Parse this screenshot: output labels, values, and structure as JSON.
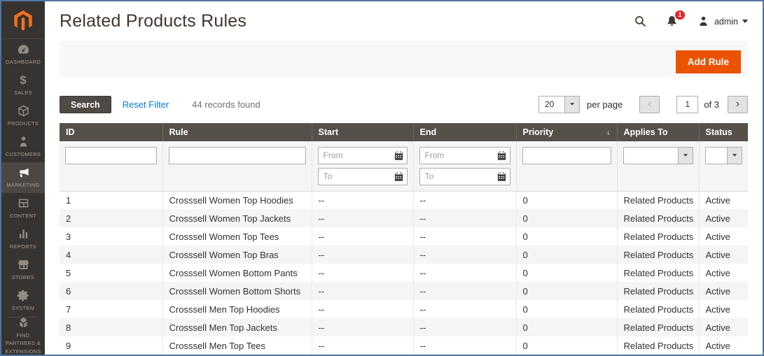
{
  "header": {
    "title": "Related Products Rules",
    "user_name": "admin",
    "notification_count": "1"
  },
  "panel": {
    "add_rule_label": "Add Rule"
  },
  "toolbar": {
    "search_label": "Search",
    "reset_filter_label": "Reset Filter",
    "records_found": "44 records found",
    "page_size": "20",
    "per_page_label": "per page",
    "current_page": "1",
    "of_label": "of 3",
    "prev_icon": "‹",
    "next_icon": "›"
  },
  "sidebar": {
    "items": [
      {
        "id": "dashboard",
        "label": "DASHBOARD",
        "icon": "dashboard-icon",
        "active": false
      },
      {
        "id": "sales",
        "label": "SALES",
        "icon": "sales-icon",
        "active": false
      },
      {
        "id": "products",
        "label": "PRODUCTS",
        "icon": "products-icon",
        "active": false
      },
      {
        "id": "customers",
        "label": "CUSTOMERS",
        "icon": "customers-icon",
        "active": false
      },
      {
        "id": "marketing",
        "label": "MARKETING",
        "icon": "marketing-icon",
        "active": true
      },
      {
        "id": "content",
        "label": "CONTENT",
        "icon": "content-icon",
        "active": false
      },
      {
        "id": "reports",
        "label": "REPORTS",
        "icon": "reports-icon",
        "active": false
      },
      {
        "id": "stores",
        "label": "STORES",
        "icon": "stores-icon",
        "active": false
      },
      {
        "id": "system",
        "label": "SYSTEM",
        "icon": "system-icon",
        "active": false
      },
      {
        "id": "find-partners",
        "label": "FIND PARTNERS & EXTENSIONS",
        "icon": "find-partners-icon",
        "active": false,
        "divider_before": true
      }
    ]
  },
  "table": {
    "columns": [
      {
        "label": "ID"
      },
      {
        "label": "Rule"
      },
      {
        "label": "Start"
      },
      {
        "label": "End"
      },
      {
        "label": "Priority"
      },
      {
        "label": "Applies To"
      },
      {
        "label": "Status"
      }
    ],
    "sort_indicator": "↓",
    "sorted_column": "Priority",
    "filters": {
      "from_placeholder": "From",
      "to_placeholder": "To",
      "id_value": "",
      "rule_value": "",
      "priority_value": "",
      "applies_to_value": "",
      "status_value": ""
    },
    "rows": [
      {
        "id": "1",
        "rule": "Crosssell Women Top Hoodies",
        "start": "--",
        "end": "--",
        "priority": "0",
        "applies_to": "Related Products",
        "status": "Active"
      },
      {
        "id": "2",
        "rule": "Crosssell Women Top Jackets",
        "start": "--",
        "end": "--",
        "priority": "0",
        "applies_to": "Related Products",
        "status": "Active"
      },
      {
        "id": "3",
        "rule": "Crosssell Women Top Tees",
        "start": "--",
        "end": "--",
        "priority": "0",
        "applies_to": "Related Products",
        "status": "Active"
      },
      {
        "id": "4",
        "rule": "Crosssell Women Top Bras",
        "start": "--",
        "end": "--",
        "priority": "0",
        "applies_to": "Related Products",
        "status": "Active"
      },
      {
        "id": "5",
        "rule": "Crosssell Women Bottom Pants",
        "start": "--",
        "end": "--",
        "priority": "0",
        "applies_to": "Related Products",
        "status": "Active"
      },
      {
        "id": "6",
        "rule": "Crosssell Women Bottom Shorts",
        "start": "--",
        "end": "--",
        "priority": "0",
        "applies_to": "Related Products",
        "status": "Active"
      },
      {
        "id": "7",
        "rule": "Crosssell Men Top Hoodies",
        "start": "--",
        "end": "--",
        "priority": "0",
        "applies_to": "Related Products",
        "status": "Active"
      },
      {
        "id": "8",
        "rule": "Crosssell Men Top Jackets",
        "start": "--",
        "end": "--",
        "priority": "0",
        "applies_to": "Related Products",
        "status": "Active"
      },
      {
        "id": "9",
        "rule": "Crosssell Men Top Tees",
        "start": "--",
        "end": "--",
        "priority": "0",
        "applies_to": "Related Products",
        "status": "Active"
      }
    ]
  },
  "colors": {
    "accent_orange": "#eb5202",
    "logo_orange": "#f3701e",
    "link_blue": "#007bdb",
    "grid_header_bg": "#55504a",
    "sidebar_bg": "#373330",
    "sidebar_active_bg": "#4c4743",
    "badge_red": "#e22626",
    "window_border_blue": "#4e76a6"
  }
}
